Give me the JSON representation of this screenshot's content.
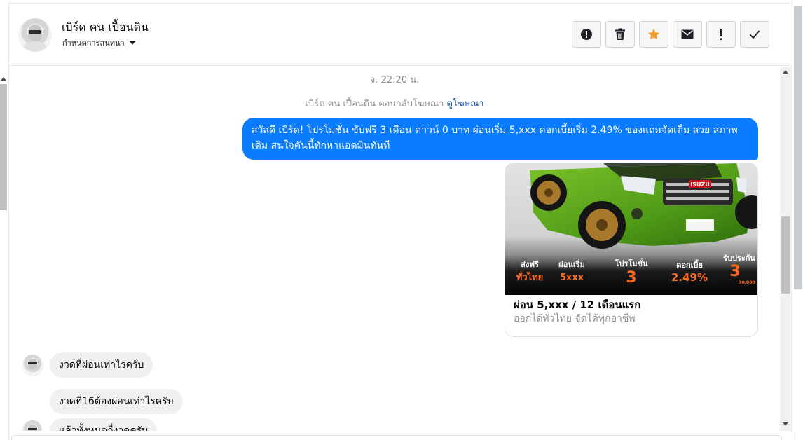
{
  "header": {
    "contact_name": "เบิร์ด คน เปื้อนดิน",
    "conversation_settings": "กำหนดการสนทนา",
    "actions": [
      {
        "name": "report-spam-button",
        "icon": "alert-circle-icon"
      },
      {
        "name": "delete-button",
        "icon": "trash-icon"
      },
      {
        "name": "star-button",
        "icon": "star-icon"
      },
      {
        "name": "mark-unread-button",
        "icon": "envelope-icon"
      },
      {
        "name": "follow-up-button",
        "icon": "exclamation-icon"
      },
      {
        "name": "mark-done-button",
        "icon": "check-icon"
      }
    ]
  },
  "colors": {
    "outgoing_bubble": "#0a7cff",
    "incoming_bubble": "#f0f0f0",
    "star": "#f29a2e",
    "link": "#1d4fa5",
    "car_body": "#5aa21f"
  },
  "messages": {
    "timestamp": "จ. 22:20 น.",
    "ad_reply_prefix": "เบิร์ด คน เปื้อนดิน ตอบกลับโฆษณา",
    "ad_reply_link": "ดูโฆษณา",
    "outgoing_text": "สวัสดี เบิร์ด! โปรโมชั่น ขับฟรี 3 เดือน ดาวน์ 0 บาท ผ่อนเริ่ม 5,xxx  ดอกเบี้ยเริ่ม 2.49% ของแถมจัดเต็ม สวย สภาพเดิม สนใจคันนี้ทักหาแอดมินทันที",
    "ad_card": {
      "title": "ผ่อน 5,xxx / 12 เดือนแรก",
      "subtitle": "ออกได้ทั่วไทย จัดได้ทุกอาชีพ",
      "image": {
        "brand_badge": "ISUZU",
        "promos": [
          {
            "label": "ส่งฟรี",
            "value": "ทั่วไทย"
          },
          {
            "label": "ผ่อนเริ่ม",
            "value": "5xxx"
          },
          {
            "label": "โปรโมชั่น",
            "value": "3"
          },
          {
            "label": "ดอกเบี้ย",
            "value": "2.49%"
          },
          {
            "label": "รับประกัน",
            "value": "3",
            "extra": "30,000"
          }
        ]
      }
    },
    "incoming": [
      "งวดที่ผ่อนเท่าไรครับ",
      "งวดที่16ต้องผ่อนเท่าไรครับ",
      "แล้วทั้งหมดกี่งวดครับ"
    ]
  }
}
